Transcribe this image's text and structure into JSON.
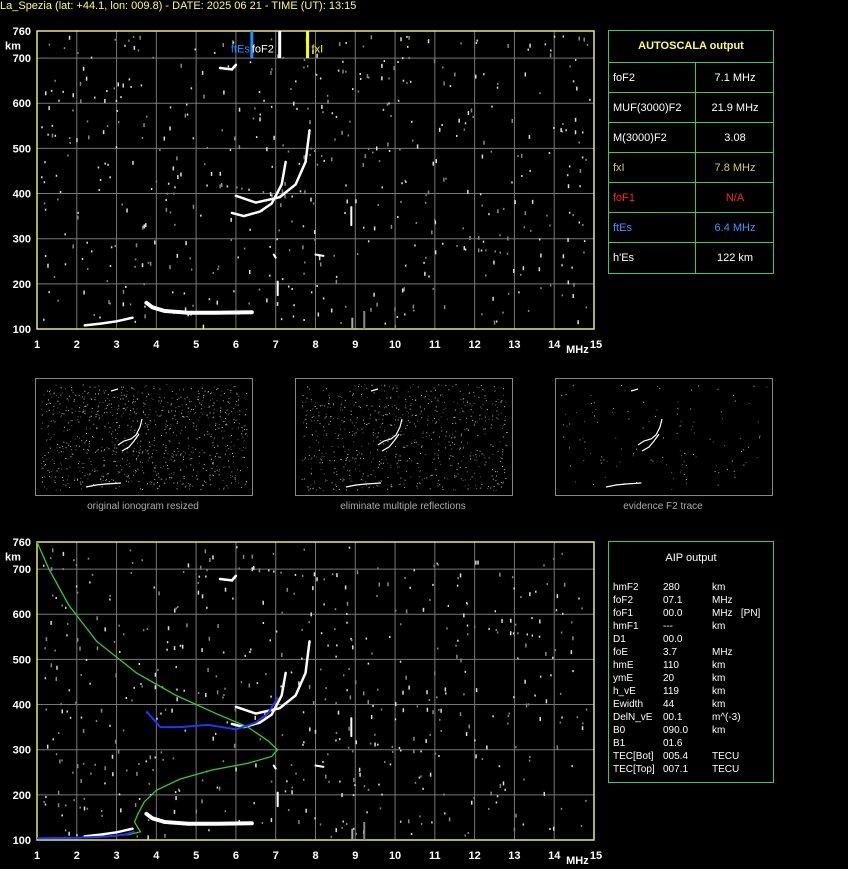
{
  "header": {
    "title": "La_Spezia (lat: +44.1, lon: 009.8) - DATE: 2025 06 21 - TIME (UT): 13:15"
  },
  "ionogram": {
    "y_unit": "km",
    "x_unit": "MHz",
    "y_ticks": [
      "760",
      "700",
      "600",
      "500",
      "400",
      "300",
      "200",
      "100"
    ],
    "x_ticks": [
      "1",
      "2",
      "3",
      "4",
      "5",
      "6",
      "7",
      "8",
      "9",
      "10",
      "11",
      "12",
      "13",
      "14",
      "15"
    ],
    "markers": {
      "ftEs": "ftEs",
      "foF2": "foF2",
      "fxI": "fxI"
    }
  },
  "autoscala": {
    "title": "AUTOSCALA output",
    "rows": [
      {
        "key": "foF2",
        "value": "7.1 MHz",
        "color": "#ffffff"
      },
      {
        "key": "MUF(3000)F2",
        "value": "21.9 MHz",
        "color": "#ffffff"
      },
      {
        "key": "M(3000)F2",
        "value": "3.08",
        "color": "#ffffff"
      },
      {
        "key": "fxI",
        "value": "7.8 MHz",
        "color": "#cccc66"
      },
      {
        "key": "foF1",
        "value": "N/A",
        "color": "#ff2222"
      },
      {
        "key": "ftEs",
        "value": "6.4 MHz",
        "color": "#3399ff"
      },
      {
        "key": "h'Es",
        "value": "122     km",
        "color": "#ffffff"
      }
    ]
  },
  "thumbnails": [
    {
      "caption": "original ionogram resized"
    },
    {
      "caption": "eliminate multiple reflections"
    },
    {
      "caption": "evidence F2 trace"
    }
  ],
  "aip": {
    "title": "AIP output",
    "rows": [
      {
        "k": "hmF2",
        "v": "280",
        "u": "km"
      },
      {
        "k": "foF2",
        "v": "07.1",
        "u": "MHz"
      },
      {
        "k": "foF1",
        "v": "00.0",
        "u": "MHz   [PN]"
      },
      {
        "k": "hmF1",
        "v": "---",
        "u": "km"
      },
      {
        "k": "D1",
        "v": "00.0",
        "u": ""
      },
      {
        "k": "foE",
        "v": "3.7",
        "u": "MHz"
      },
      {
        "k": "hmE",
        "v": "110",
        "u": "km"
      },
      {
        "k": "ymE",
        "v": "20",
        "u": "km"
      },
      {
        "k": "h_vE",
        "v": "119",
        "u": "km"
      },
      {
        "k": "Ewidth",
        "v": "44",
        "u": "km"
      },
      {
        "k": "DelN_vE",
        "v": "00.1",
        "u": "m^(-3)"
      },
      {
        "k": "B0",
        "v": "090.0",
        "u": "km"
      },
      {
        "k": "B1",
        "v": "01.6",
        "u": ""
      },
      {
        "k": "TEC[Bot]",
        "v": "005.4",
        "u": "TECU"
      },
      {
        "k": "TEC[Top]",
        "v": "007.1",
        "u": "TECU"
      }
    ]
  },
  "colors": {
    "grid": "#777777",
    "frame": "#e8e870",
    "panel_border": "#33cc66",
    "ftEs_marker": "#1e90ff",
    "fxI_marker": "#ffff00",
    "profile_green": "#33cc33",
    "profile_blue": "#2233ff"
  }
}
